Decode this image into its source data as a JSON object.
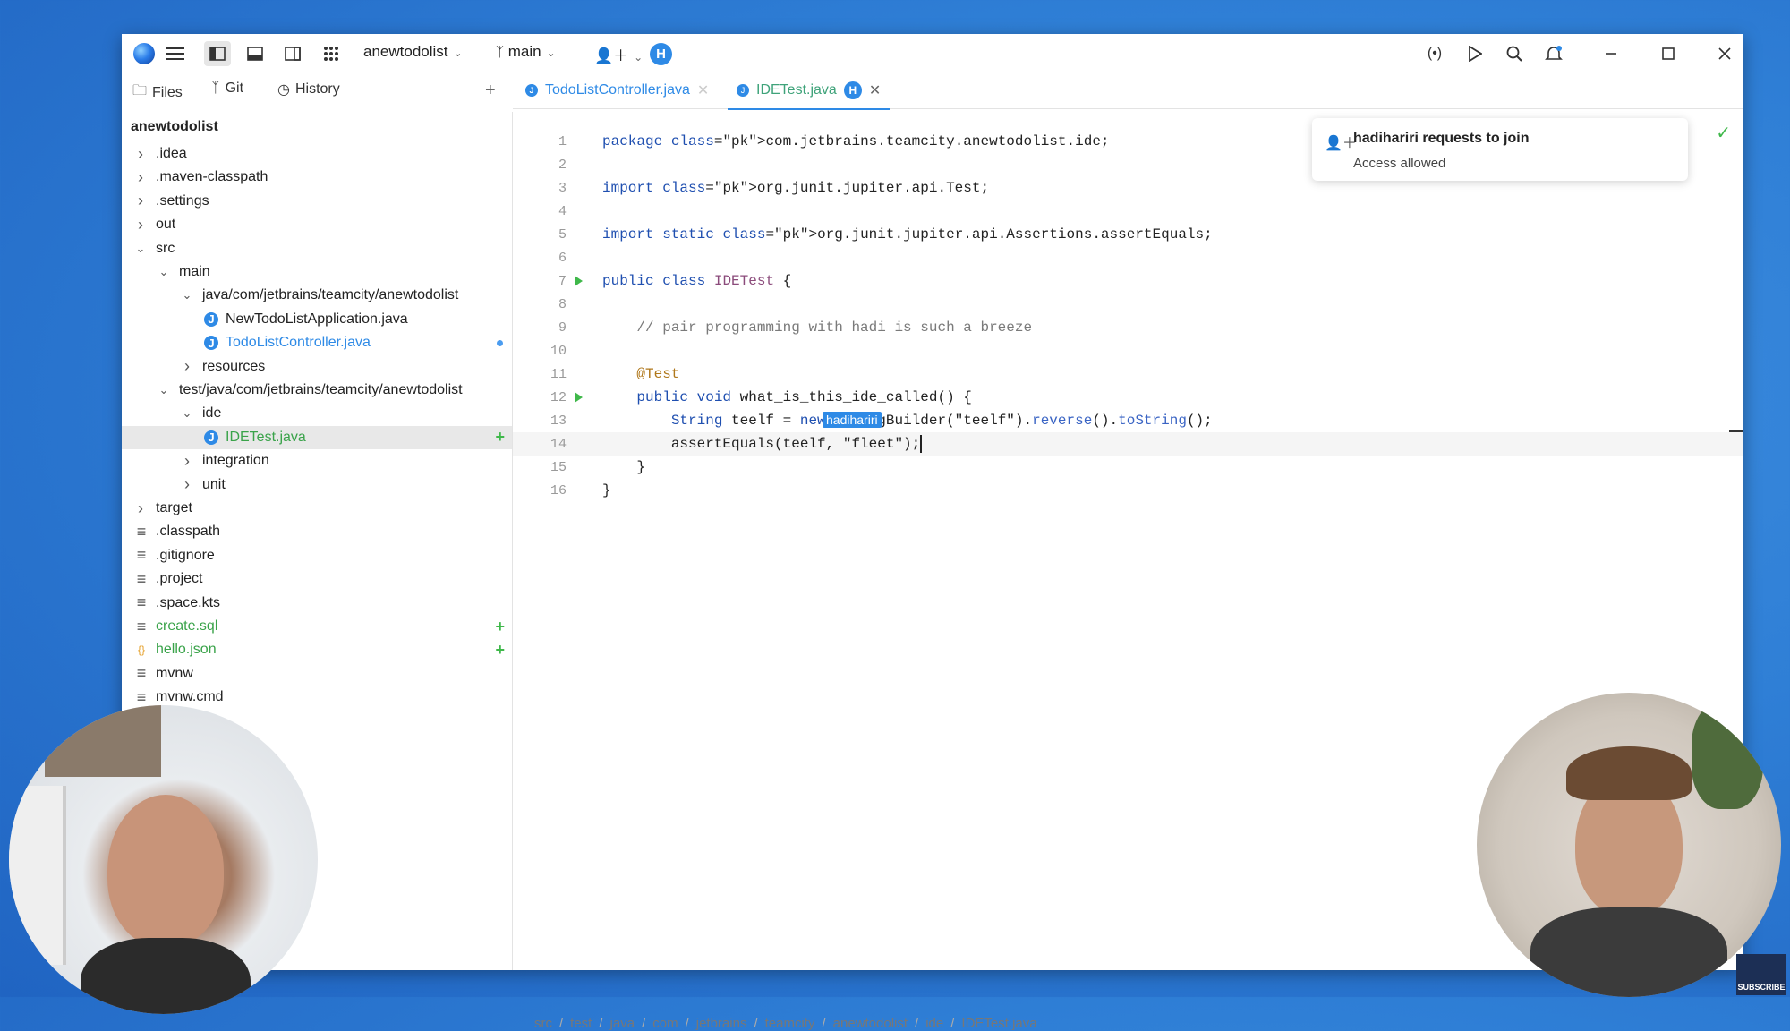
{
  "toolbar": {
    "project_name": "anewtodolist",
    "branch": "main",
    "collaborator_initial": "H"
  },
  "sidebar": {
    "tabs": [
      "Files",
      "Git",
      "History"
    ],
    "project_title": "anewtodolist",
    "items": [
      {
        "label": ".idea",
        "type": "folder",
        "expanded": false
      },
      {
        "label": ".maven-classpath",
        "type": "folder",
        "expanded": false
      },
      {
        "label": ".settings",
        "type": "folder",
        "expanded": false
      },
      {
        "label": "out",
        "type": "folder",
        "expanded": false
      },
      {
        "label": "src",
        "type": "folder",
        "expanded": true
      },
      {
        "label": "main",
        "type": "folder",
        "expanded": true
      },
      {
        "label": "java/com/jetbrains/teamcity/anewtodolist",
        "type": "folder",
        "expanded": true
      },
      {
        "label": "NewTodoListApplication.java",
        "type": "java"
      },
      {
        "label": "TodoListController.java",
        "type": "java",
        "status": "modified"
      },
      {
        "label": "resources",
        "type": "folder",
        "expanded": false
      },
      {
        "label": "test/java/com/jetbrains/teamcity/anewtodolist",
        "type": "folder",
        "expanded": true
      },
      {
        "label": "ide",
        "type": "folder",
        "expanded": true
      },
      {
        "label": "IDETest.java",
        "type": "java",
        "status": "added",
        "selected": true
      },
      {
        "label": "integration",
        "type": "folder",
        "expanded": false
      },
      {
        "label": "unit",
        "type": "folder",
        "expanded": false
      },
      {
        "label": "target",
        "type": "folder",
        "expanded": false
      },
      {
        "label": ".classpath",
        "type": "file"
      },
      {
        "label": ".gitignore",
        "type": "file"
      },
      {
        "label": ".project",
        "type": "file"
      },
      {
        "label": ".space.kts",
        "type": "file"
      },
      {
        "label": "create.sql",
        "type": "file",
        "status": "added"
      },
      {
        "label": "hello.json",
        "type": "json",
        "status": "added"
      },
      {
        "label": "mvnw",
        "type": "file"
      },
      {
        "label": "mvnw.cmd",
        "type": "file"
      }
    ]
  },
  "editor_tabs": [
    {
      "label": "TodoListController.java",
      "active": false
    },
    {
      "label": "IDETest.java",
      "active": true,
      "badge": "H"
    }
  ],
  "code_lines": [
    {
      "n": "1",
      "text": "package com.jetbrains.teamcity.anewtodolist.ide;"
    },
    {
      "n": "2",
      "text": ""
    },
    {
      "n": "3",
      "text": "import org.junit.jupiter.api.Test;"
    },
    {
      "n": "4",
      "text": ""
    },
    {
      "n": "5",
      "text": "import static org.junit.jupiter.api.Assertions.assertEquals;"
    },
    {
      "n": "6",
      "text": ""
    },
    {
      "n": "7",
      "text": "public class IDETest {"
    },
    {
      "n": "8",
      "text": ""
    },
    {
      "n": "9",
      "text": "    // pair programming with hadi is such a breeze"
    },
    {
      "n": "10",
      "text": ""
    },
    {
      "n": "11",
      "text": "    @Test"
    },
    {
      "n": "12",
      "text": "    public void what_is_this_ide_called() {"
    },
    {
      "n": "13",
      "text": "        String teelf = new StringBuilder(\"teelf\").reverse().toString();"
    },
    {
      "n": "14",
      "text": "        assertEquals(teelf, \"fleet\");"
    },
    {
      "n": "15",
      "text": "    }"
    },
    {
      "n": "16",
      "text": "}"
    }
  ],
  "collaborator_cursor_label": "hadihariri",
  "notification": {
    "title": "hadihariri requests to join",
    "body": "Access allowed"
  },
  "breadcrumb": [
    "src",
    "test",
    "java",
    "com",
    "jetbrains",
    "teamcity",
    "anewtodolist",
    "ide",
    "IDETest.java"
  ],
  "overlay": {
    "subscribe_label": "SUBSCRIBE"
  },
  "colors": {
    "accent": "#2e8ae6",
    "added": "#3fb84a",
    "background": "#2f7fd6"
  }
}
